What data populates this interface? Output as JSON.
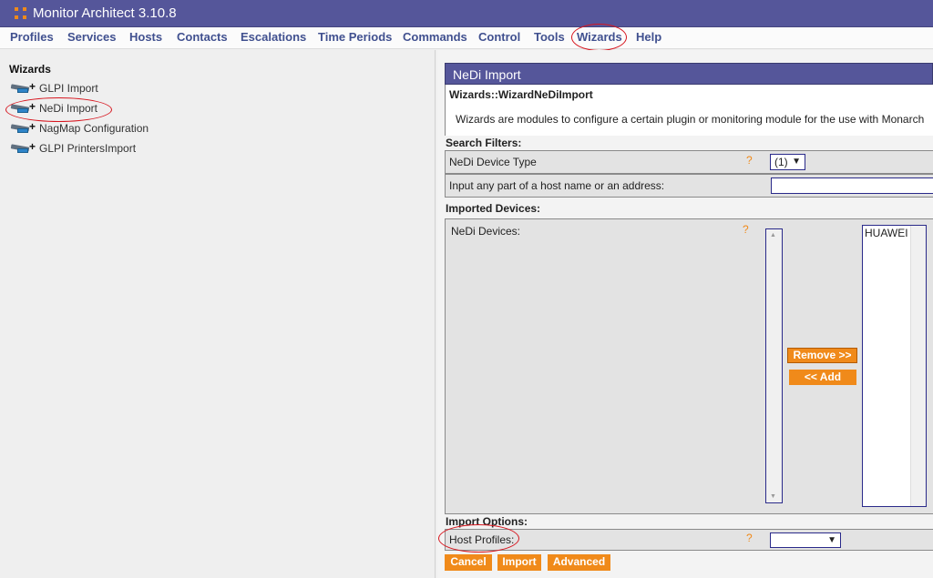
{
  "app": {
    "title": "Monitor Architect 3.10.8"
  },
  "menu": {
    "items": [
      "Profiles",
      "Services",
      "Hosts",
      "Contacts",
      "Escalations",
      "Time Periods",
      "Commands",
      "Control",
      "Tools",
      "Wizards",
      "Help"
    ]
  },
  "sidebar": {
    "title": "Wizards",
    "items": [
      "GLPI Import",
      "NeDi Import",
      "NagMap Configuration",
      "GLPI PrintersImport"
    ]
  },
  "panel": {
    "header": "NeDi Import",
    "subtitle": "Wizards::WizardNeDiImport",
    "description": "Wizards are modules to configure a certain plugin or monitoring module for the use with Monarch",
    "search_filters_label": "Search Filters:",
    "device_type_label": "NeDi Device Type",
    "device_type_value": "(1)",
    "host_input_label": "Input any part of a host name or an address:",
    "host_input_value": "",
    "imported_devices_label": "Imported Devices:",
    "nedi_devices_label": "NeDi Devices:",
    "available_devices": [],
    "selected_devices": [
      "HUAWEI"
    ],
    "remove_button": "Remove >>",
    "add_button": "<< Add",
    "import_options_label": "Import Options:",
    "host_profiles_label": "Host Profiles:",
    "host_profiles_value": "",
    "help_mark": "?",
    "buttons": {
      "cancel": "Cancel",
      "import": "Import",
      "advanced": "Advanced"
    }
  },
  "colors": {
    "title_bar": "#55569a",
    "accent": "#f08a1a",
    "menu_text": "#40508f",
    "annotation": "#d7161f"
  }
}
